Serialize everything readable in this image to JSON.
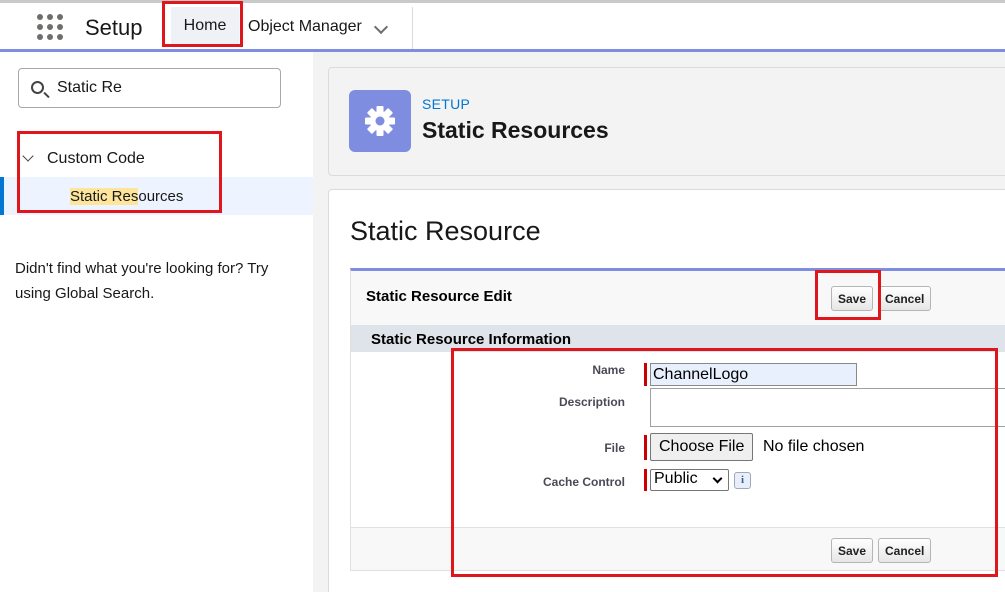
{
  "header": {
    "app_name": "Setup",
    "nav": [
      {
        "label": "Home"
      },
      {
        "label": "Object Manager"
      }
    ]
  },
  "sidebar": {
    "search_value": "Static Re",
    "tree_parent": "Custom Code",
    "tree_child_match": "Static Res",
    "tree_child_rest": "ources",
    "help_text": "Didn't find what you're looking for? Try using Global Search."
  },
  "page_header": {
    "eyebrow": "SETUP",
    "title": "Static Resources"
  },
  "main": {
    "page_title": "Static Resource",
    "edit_title": "Static Resource Edit",
    "save_label": "Save",
    "cancel_label": "Cancel",
    "section_title": "Static Resource Information",
    "fields": {
      "name_label": "Name",
      "name_value": "ChannelLogo",
      "description_label": "Description",
      "file_label": "File",
      "file_button": "Choose File",
      "file_status": "No file chosen",
      "cache_label": "Cache Control",
      "cache_value": "Public",
      "info_glyph": "i"
    }
  },
  "colors": {
    "accent": "#7f8de1",
    "brand_blue": "#0176d3",
    "highlight_red": "#e0161d",
    "search_highlight": "#fde59b"
  },
  "icons": [
    "app-launcher-icon",
    "chevron-down-icon",
    "search-icon",
    "gear-icon",
    "info-icon"
  ]
}
